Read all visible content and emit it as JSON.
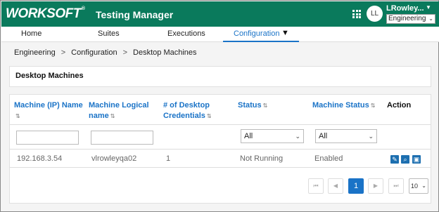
{
  "header": {
    "logo": "WORKSOFT",
    "logo_mark": "®",
    "app_title": "Testing Manager",
    "avatar_initials": "LL",
    "user_name": "LRowley...",
    "environment": "Engineering",
    "header_color": "#0a7a5c"
  },
  "nav": {
    "tabs": [
      {
        "label": "Home"
      },
      {
        "label": "Suites"
      },
      {
        "label": "Executions"
      },
      {
        "label": "Configuration",
        "active": true
      }
    ],
    "active_color": "#1a73c7"
  },
  "breadcrumb": [
    "Engineering",
    "Configuration",
    "Desktop Machines"
  ],
  "panel": {
    "title": "Desktop Machines"
  },
  "table": {
    "columns": [
      {
        "line1": "Machine (IP) Name",
        "line2": "",
        "sort": "⇅"
      },
      {
        "line1": "Machine Logical",
        "line2": "name",
        "sort": "⇅"
      },
      {
        "line1": "# of Desktop",
        "line2": "Credentials",
        "sort": "⇅"
      },
      {
        "line1": "Status",
        "line2": "",
        "sort": "⇅"
      },
      {
        "line1": "Machine Status",
        "line2": "",
        "sort": "⇅"
      },
      {
        "line1": "Action",
        "line2": "",
        "sort": ""
      }
    ],
    "filters": {
      "machine_name": "",
      "logical_name": "",
      "status": "All",
      "machine_status": "All"
    },
    "rows": [
      {
        "machine_name": "192.168.3.54",
        "logical_name": "vlrowleyqa02",
        "credentials": "1",
        "status": "Not Running",
        "machine_status": "Enabled"
      }
    ],
    "actions": [
      "edit-icon",
      "search-icon",
      "remote-desktop-icon"
    ]
  },
  "pagination": {
    "first": "⏮",
    "prev": "◀",
    "current_page": "1",
    "next": "▶",
    "last": "⏭",
    "page_size": "10"
  }
}
